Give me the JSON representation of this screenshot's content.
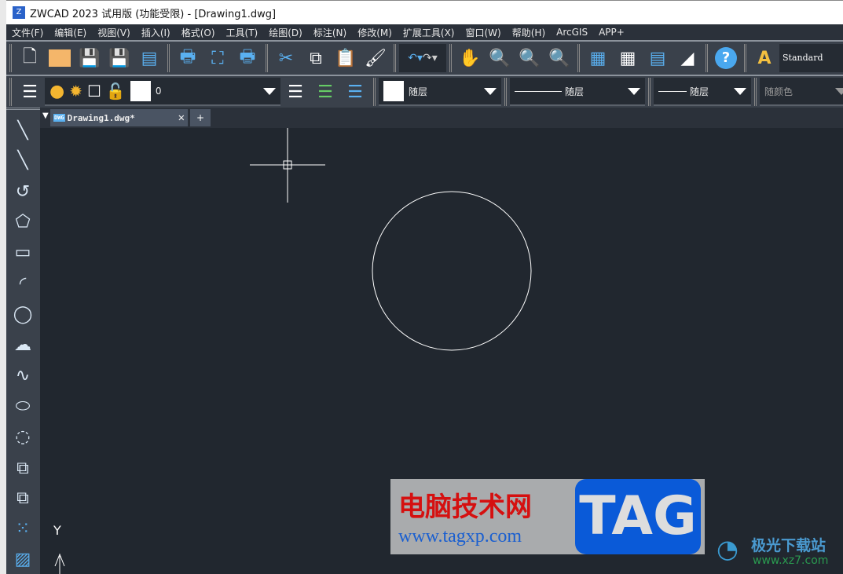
{
  "window": {
    "title": "ZWCAD 2023 试用版 (功能受限) - [Drawing1.dwg]"
  },
  "menu": [
    "文件(F)",
    "编辑(E)",
    "视图(V)",
    "插入(I)",
    "格式(O)",
    "工具(T)",
    "绘图(D)",
    "标注(N)",
    "修改(M)",
    "扩展工具(X)",
    "窗口(W)",
    "帮助(H)",
    "ArcGIS",
    "APP+"
  ],
  "toolbar1": {
    "text_style": "Standard"
  },
  "toolbar2": {
    "layer": "0",
    "color": "随层",
    "linetype": "随层",
    "lineweight": "随层",
    "plotstyle": "随颜色"
  },
  "tabs": {
    "active": "Drawing1.dwg*"
  },
  "ucs": {
    "y_label": "Y"
  },
  "watermarks": {
    "site1": "电脑技术网",
    "url1": "www.tagxp.com",
    "badge": "TAG",
    "site2": "极光下载站",
    "url2": "www.xz7.com"
  },
  "colors": {
    "canvas": "#21272f",
    "toolbar": "#3a414b",
    "accent": "#4aa8ef"
  }
}
